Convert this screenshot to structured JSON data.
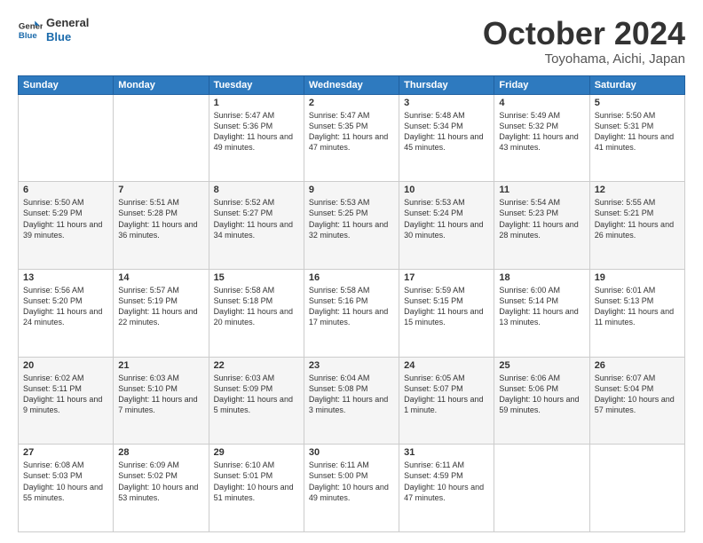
{
  "logo": {
    "line1": "General",
    "line2": "Blue"
  },
  "header": {
    "month": "October 2024",
    "location": "Toyohama, Aichi, Japan"
  },
  "weekdays": [
    "Sunday",
    "Monday",
    "Tuesday",
    "Wednesday",
    "Thursday",
    "Friday",
    "Saturday"
  ],
  "weeks": [
    [
      {
        "day": "",
        "content": ""
      },
      {
        "day": "",
        "content": ""
      },
      {
        "day": "1",
        "content": "Sunrise: 5:47 AM\nSunset: 5:36 PM\nDaylight: 11 hours and 49 minutes."
      },
      {
        "day": "2",
        "content": "Sunrise: 5:47 AM\nSunset: 5:35 PM\nDaylight: 11 hours and 47 minutes."
      },
      {
        "day": "3",
        "content": "Sunrise: 5:48 AM\nSunset: 5:34 PM\nDaylight: 11 hours and 45 minutes."
      },
      {
        "day": "4",
        "content": "Sunrise: 5:49 AM\nSunset: 5:32 PM\nDaylight: 11 hours and 43 minutes."
      },
      {
        "day": "5",
        "content": "Sunrise: 5:50 AM\nSunset: 5:31 PM\nDaylight: 11 hours and 41 minutes."
      }
    ],
    [
      {
        "day": "6",
        "content": "Sunrise: 5:50 AM\nSunset: 5:29 PM\nDaylight: 11 hours and 39 minutes."
      },
      {
        "day": "7",
        "content": "Sunrise: 5:51 AM\nSunset: 5:28 PM\nDaylight: 11 hours and 36 minutes."
      },
      {
        "day": "8",
        "content": "Sunrise: 5:52 AM\nSunset: 5:27 PM\nDaylight: 11 hours and 34 minutes."
      },
      {
        "day": "9",
        "content": "Sunrise: 5:53 AM\nSunset: 5:25 PM\nDaylight: 11 hours and 32 minutes."
      },
      {
        "day": "10",
        "content": "Sunrise: 5:53 AM\nSunset: 5:24 PM\nDaylight: 11 hours and 30 minutes."
      },
      {
        "day": "11",
        "content": "Sunrise: 5:54 AM\nSunset: 5:23 PM\nDaylight: 11 hours and 28 minutes."
      },
      {
        "day": "12",
        "content": "Sunrise: 5:55 AM\nSunset: 5:21 PM\nDaylight: 11 hours and 26 minutes."
      }
    ],
    [
      {
        "day": "13",
        "content": "Sunrise: 5:56 AM\nSunset: 5:20 PM\nDaylight: 11 hours and 24 minutes."
      },
      {
        "day": "14",
        "content": "Sunrise: 5:57 AM\nSunset: 5:19 PM\nDaylight: 11 hours and 22 minutes."
      },
      {
        "day": "15",
        "content": "Sunrise: 5:58 AM\nSunset: 5:18 PM\nDaylight: 11 hours and 20 minutes."
      },
      {
        "day": "16",
        "content": "Sunrise: 5:58 AM\nSunset: 5:16 PM\nDaylight: 11 hours and 17 minutes."
      },
      {
        "day": "17",
        "content": "Sunrise: 5:59 AM\nSunset: 5:15 PM\nDaylight: 11 hours and 15 minutes."
      },
      {
        "day": "18",
        "content": "Sunrise: 6:00 AM\nSunset: 5:14 PM\nDaylight: 11 hours and 13 minutes."
      },
      {
        "day": "19",
        "content": "Sunrise: 6:01 AM\nSunset: 5:13 PM\nDaylight: 11 hours and 11 minutes."
      }
    ],
    [
      {
        "day": "20",
        "content": "Sunrise: 6:02 AM\nSunset: 5:11 PM\nDaylight: 11 hours and 9 minutes."
      },
      {
        "day": "21",
        "content": "Sunrise: 6:03 AM\nSunset: 5:10 PM\nDaylight: 11 hours and 7 minutes."
      },
      {
        "day": "22",
        "content": "Sunrise: 6:03 AM\nSunset: 5:09 PM\nDaylight: 11 hours and 5 minutes."
      },
      {
        "day": "23",
        "content": "Sunrise: 6:04 AM\nSunset: 5:08 PM\nDaylight: 11 hours and 3 minutes."
      },
      {
        "day": "24",
        "content": "Sunrise: 6:05 AM\nSunset: 5:07 PM\nDaylight: 11 hours and 1 minute."
      },
      {
        "day": "25",
        "content": "Sunrise: 6:06 AM\nSunset: 5:06 PM\nDaylight: 10 hours and 59 minutes."
      },
      {
        "day": "26",
        "content": "Sunrise: 6:07 AM\nSunset: 5:04 PM\nDaylight: 10 hours and 57 minutes."
      }
    ],
    [
      {
        "day": "27",
        "content": "Sunrise: 6:08 AM\nSunset: 5:03 PM\nDaylight: 10 hours and 55 minutes."
      },
      {
        "day": "28",
        "content": "Sunrise: 6:09 AM\nSunset: 5:02 PM\nDaylight: 10 hours and 53 minutes."
      },
      {
        "day": "29",
        "content": "Sunrise: 6:10 AM\nSunset: 5:01 PM\nDaylight: 10 hours and 51 minutes."
      },
      {
        "day": "30",
        "content": "Sunrise: 6:11 AM\nSunset: 5:00 PM\nDaylight: 10 hours and 49 minutes."
      },
      {
        "day": "31",
        "content": "Sunrise: 6:11 AM\nSunset: 4:59 PM\nDaylight: 10 hours and 47 minutes."
      },
      {
        "day": "",
        "content": ""
      },
      {
        "day": "",
        "content": ""
      }
    ]
  ]
}
